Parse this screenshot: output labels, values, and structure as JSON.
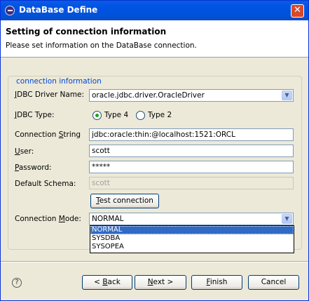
{
  "window": {
    "title": "DataBase Define",
    "close_symbol": "✕"
  },
  "header": {
    "title": "Setting of connection information",
    "description": "Please set information on the DataBase connection."
  },
  "group": {
    "label": "connection information"
  },
  "form": {
    "driver_name": {
      "label_mnemonic": "J",
      "label_rest": "DBC Driver Name:",
      "value": "oracle.jdbc.driver.OracleDriver"
    },
    "jdbc_type": {
      "label_pre": "",
      "label_mnemonic": "J",
      "label_rest": "DBC Type:",
      "options": [
        "Type 4",
        "Type 2"
      ],
      "selected": "Type 4"
    },
    "connection_string": {
      "label_pre": "Connection ",
      "label_mnemonic": "S",
      "label_rest": "tring",
      "value": "jdbc:oracle:thin:@localhost:1521:ORCL"
    },
    "user": {
      "label_mnemonic": "U",
      "label_rest": "ser:",
      "value": "scott"
    },
    "password": {
      "label_mnemonic": "P",
      "label_rest": "assword:",
      "value": "*****"
    },
    "default_schema": {
      "label": "Default Schema:",
      "value": "scott"
    },
    "test_button": {
      "mnemonic": "T",
      "rest": "est connection"
    },
    "connection_mode": {
      "label_pre": "Connection ",
      "label_mnemonic": "M",
      "label_rest": "ode:",
      "value": "NORMAL",
      "options": [
        "NORMAL",
        "SYSDBA",
        "SYSOPEA"
      ],
      "highlighted": "NORMAL"
    }
  },
  "footer": {
    "help_symbol": "?",
    "back": {
      "pre": "< ",
      "mnemonic": "B",
      "rest": "ack"
    },
    "next": {
      "mnemonic": "N",
      "rest": "ext >"
    },
    "finish": {
      "mnemonic": "F",
      "rest": "inish"
    },
    "cancel": "Cancel"
  }
}
